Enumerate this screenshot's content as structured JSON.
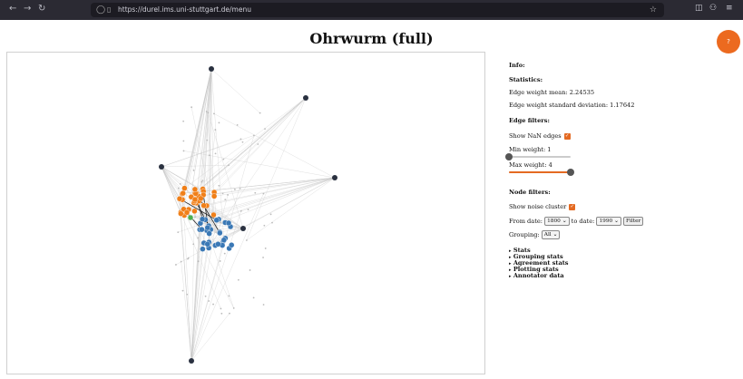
{
  "browser": {
    "url": "https://durel.ims.uni-stuttgart.de/menu"
  },
  "page": {
    "title": "Ohrwurm (full)",
    "help_label": "?"
  },
  "panel": {
    "info_label": "Info:",
    "statistics_label": "Statistics:",
    "edge_weight_mean": "Edge weight mean: 2.24535",
    "edge_weight_std": "Edge weight standard deviation: 1.17642",
    "edge_filters_label": "Edge filters:",
    "show_nan_edges": "Show NaN edges",
    "min_weight": "Min weight: 1",
    "min_weight_value": 1,
    "max_weight": "Max weight: 4",
    "max_weight_value": 4,
    "weight_range": [
      1,
      4
    ],
    "node_filters_label": "Node filters:",
    "show_noise_cluster": "Show noise cluster",
    "from_date_label": "From date:",
    "from_date_value": "1800",
    "to_date_label": "to date:",
    "to_date_value": "1990",
    "filter_button": "Filter",
    "grouping_label": "Grouping:",
    "grouping_value": "All",
    "sections": [
      "Stats",
      "Grouping stats",
      "Agreement stats",
      "Plotting stats",
      "Annotator data"
    ]
  },
  "colors": {
    "accent": "#e46a22",
    "cluster_orange": "#f07f18",
    "cluster_blue": "#3a78b5",
    "noise_green": "#4caf50",
    "outlier_node": "#2a3140"
  }
}
